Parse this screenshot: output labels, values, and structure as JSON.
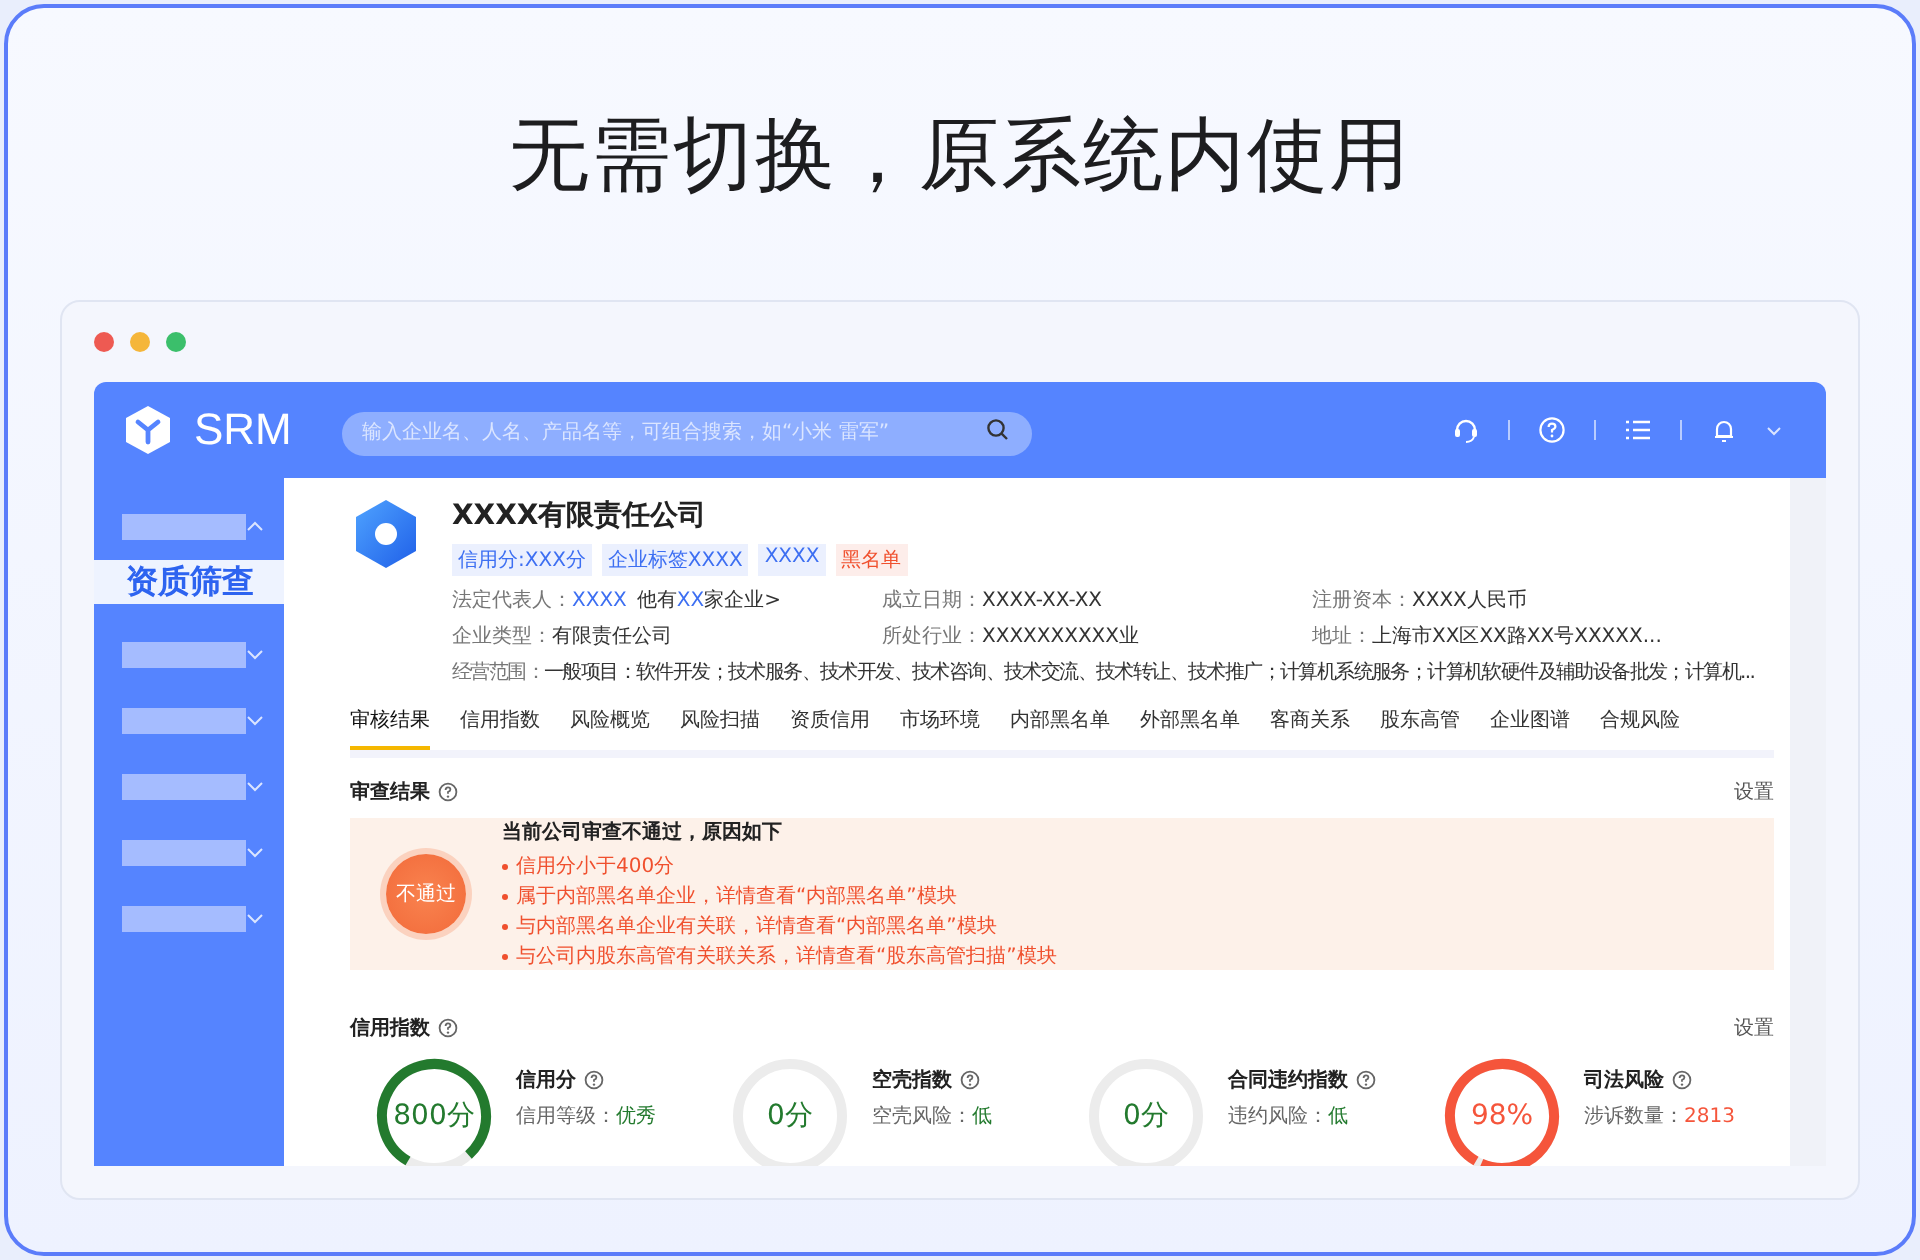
{
  "headline": "无需切换，原系统内使用",
  "app": {
    "brand": "SRM",
    "search": {
      "placeholder": "输入企业名、人名、产品名等，可组合搜索，如“小米 雷军”"
    }
  },
  "sidebar": {
    "items": [
      {
        "expanded": true,
        "children": [
          {
            "label": "资质筛查",
            "selected": true
          }
        ]
      },
      {
        "expanded": false
      },
      {
        "expanded": false
      },
      {
        "expanded": false
      },
      {
        "expanded": false
      },
      {
        "expanded": false
      }
    ]
  },
  "company": {
    "name": "XXXX有限责任公司",
    "tags": [
      {
        "text": "信用分:XXX分",
        "color": "#3d6ff2"
      },
      {
        "text": "企业标签XXXX",
        "color": "#3d6ff2"
      },
      {
        "text": "XXXX",
        "color": "#3d6ff2"
      },
      {
        "text": "黑名单",
        "color": "#f0502e"
      }
    ],
    "legal_rep": {
      "label": "法定代表人：",
      "value": "XXXX",
      "note_before": "他有",
      "note_link": "XX",
      "note_after": "家企业>"
    },
    "fields": [
      {
        "label": "成立日期：",
        "value": "XXXX-XX-XX"
      },
      {
        "label": "注册资本：",
        "value": "XXXX人民币"
      },
      {
        "label": "企业类型：",
        "value": "有限责任公司"
      },
      {
        "label": "所处行业：",
        "value": "XXXXXXXXXX业"
      },
      {
        "label": "地址：",
        "value": "上海市XX区XX路XX号XXXXX..."
      }
    ],
    "scope": {
      "label": "经营范围：",
      "value": "一般项目：软件开发；技术服务、技术开发、技术咨询、技术交流、技术转让、技术推广；计算机系统服务；计算机软硬件及辅助设备批发；计算机..."
    }
  },
  "tabs": [
    {
      "label": "审核结果",
      "selected": true
    },
    {
      "label": "信用指数",
      "selected": false
    },
    {
      "label": "风险概览",
      "selected": false
    },
    {
      "label": "风险扫描",
      "selected": false
    },
    {
      "label": "资质信用",
      "selected": false
    },
    {
      "label": "市场环境",
      "selected": false
    },
    {
      "label": "内部黑名单",
      "selected": false
    },
    {
      "label": "外部黑名单",
      "selected": false
    },
    {
      "label": "客商关系",
      "selected": false
    },
    {
      "label": "股东高管",
      "selected": false
    },
    {
      "label": "企业图谱",
      "selected": false
    },
    {
      "label": "合规风险",
      "selected": false
    }
  ],
  "review": {
    "title": "审查结果",
    "settings": "设置",
    "badge": "不通过",
    "heading": "当前公司审查不通过，原因如下",
    "reasons": [
      "信用分小于400分",
      "属于内部黑名单企业，详情查看“内部黑名单”模块",
      "与内部黑名单企业有关联，详情查看“内部黑名单”模块",
      "与公司内股东高管有关联关系，详情查看“股东高管扫描”模块"
    ]
  },
  "credit": {
    "title": "信用指数",
    "settings": "设置",
    "gauges": [
      {
        "value": "800分",
        "level": 0.8,
        "color": "#237a2e",
        "title": "信用分",
        "detail_label": "信用等级：",
        "detail_value": "优秀"
      },
      {
        "value": "0分",
        "level": 0,
        "color": "#237a2e",
        "title": "空壳指数",
        "detail_label": "空壳风险：",
        "detail_value": "低"
      },
      {
        "value": "0分",
        "level": 0,
        "color": "#237a2e",
        "title": "合同违约指数",
        "detail_label": "违约风险：",
        "detail_value": "低"
      },
      {
        "value": "98%",
        "level": 0.98,
        "color": "#f5553b",
        "title": "司法风险",
        "detail_label": "涉诉数量：",
        "detail_value": "2813"
      }
    ]
  }
}
